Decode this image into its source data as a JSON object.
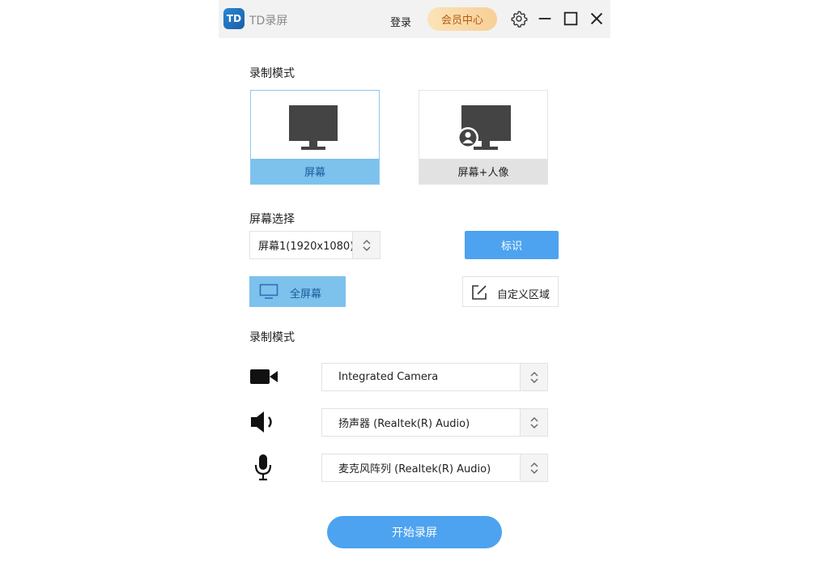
{
  "titlebar": {
    "logo_text": "TD",
    "app_name": "TD录屏",
    "login_label": "登录",
    "vip_label": "会员中心"
  },
  "record_mode": {
    "heading": "录制模式",
    "options": [
      {
        "label": "屏幕",
        "selected": true
      },
      {
        "label": "屏幕+人像",
        "selected": false
      }
    ]
  },
  "screen_select": {
    "heading": "屏幕选择",
    "selected_screen": "屏幕1(1920x1080)",
    "mark_button": "标识",
    "fullscreen_button": "全屏幕",
    "custom_area_button": "自定义区域"
  },
  "devices": {
    "heading": "录制模式",
    "camera": "Integrated Camera",
    "speaker": "扬声器 (Realtek(R) Audio)",
    "microphone": "麦克风阵列 (Realtek(R) Audio)"
  },
  "start_button": "开始录屏",
  "colors": {
    "accent_blue": "#4da3ef",
    "selected_light_blue": "#7cc2ec",
    "vip_gold": "#f8cf97"
  }
}
